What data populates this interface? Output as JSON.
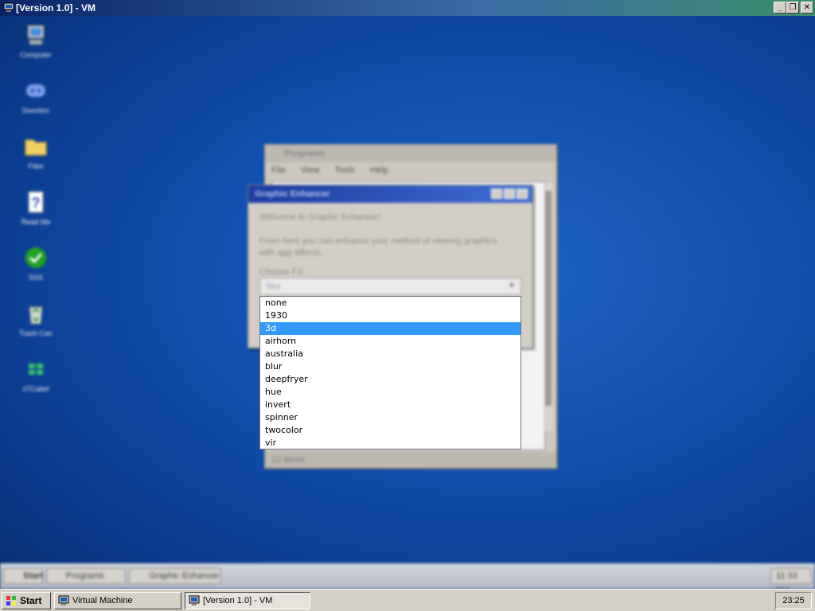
{
  "host_window": {
    "title": "[Version 1.0] - VM",
    "buttons": {
      "minimize": "_",
      "maximize": "❐",
      "close": "✕"
    }
  },
  "desktop_icons": [
    {
      "label": "Computer",
      "icon": "computer-icon"
    },
    {
      "label": "Doonbro",
      "icon": "discord-icon"
    },
    {
      "label": "Files",
      "icon": "folder-icon"
    },
    {
      "label": "Read Me",
      "icon": "readme-icon"
    },
    {
      "label": "SSS",
      "icon": "checkmark-icon"
    },
    {
      "label": "Trash Can",
      "icon": "recycle-bin-icon"
    },
    {
      "label": "sTCaltef",
      "icon": "windows-logo-icon"
    }
  ],
  "programs_window": {
    "title": "Programs",
    "menu": [
      "File",
      "View",
      "Tools",
      "Help"
    ],
    "status": "12 items"
  },
  "ge_dialog": {
    "title": "Graphic Enhancer",
    "welcome": "Welcome to Graphic Enhancer!",
    "description_line1": "From here you can enhance your method of viewing graphics",
    "description_line2": "with app effects.",
    "choose_label": "Choose FX:",
    "selected_value": "blur",
    "options": [
      "none",
      "1930",
      "3d",
      "airhorn",
      "australia",
      "blur",
      "deepfryer",
      "hue",
      "invert",
      "spinner",
      "twocolor",
      "vir"
    ],
    "highlighted_option": "3d"
  },
  "guest_taskbar": {
    "start": "Start",
    "tasks": [
      "Programs",
      "Graphic Enhancer"
    ],
    "clock": "11:33 PM"
  },
  "host_taskbar": {
    "start": "Start",
    "tasks": [
      "Virtual Machine",
      "[Version 1.0] - VM"
    ],
    "clock": "23:25"
  },
  "colors": {
    "selection": "#3399ff",
    "desktop": "#1250b0"
  }
}
